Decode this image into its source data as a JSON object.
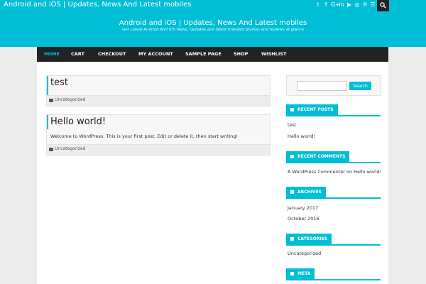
{
  "topbar": {
    "title": "Android and iOS | Updates, News And Latest mobiles",
    "social_icons": [
      "twitter-icon",
      "facebook-icon",
      "google-plus-icon",
      "linkedin-icon",
      "youtube-icon",
      "instagram-icon",
      "pinterest-icon",
      "rss-icon"
    ],
    "social_glyphs": [
      "𝕥",
      "f",
      "G+",
      "in",
      "▶",
      "◎",
      "℗",
      "☰"
    ]
  },
  "header": {
    "site_title": "Android and iOS | Updates, News And Latest mobiles",
    "tagline": "Get Latest Android And iOS News, Updates and latest branded phones and reviews at glance"
  },
  "nav": {
    "items": [
      "HOME",
      "CART",
      "CHECKOUT",
      "MY ACCOUNT",
      "SAMPLE PAGE",
      "SHOP",
      "WISHLIST"
    ]
  },
  "posts": [
    {
      "title": "test",
      "category": "Uncategorized"
    },
    {
      "title": "Hello world!",
      "excerpt": "Welcome to WordPress. This is your first post. Edit or delete it, then start writing!",
      "category": "Uncategorized"
    }
  ],
  "sidebar": {
    "search_button": "Search",
    "widgets": [
      {
        "title": "RECENT POSTS",
        "items": [
          "test",
          "Hello world!"
        ]
      },
      {
        "title": "RECENT COMMENTS",
        "items": [
          "A WordPress Commenter on Hello world!"
        ]
      },
      {
        "title": "ARCHIVES",
        "items": [
          "January 2017",
          "October 2016"
        ]
      },
      {
        "title": "CATEGORIES",
        "items": [
          "Uncategorized"
        ]
      },
      {
        "title": "META",
        "items": []
      }
    ]
  },
  "colors": {
    "accent": "#00bed6",
    "nav_bg": "#222222"
  }
}
